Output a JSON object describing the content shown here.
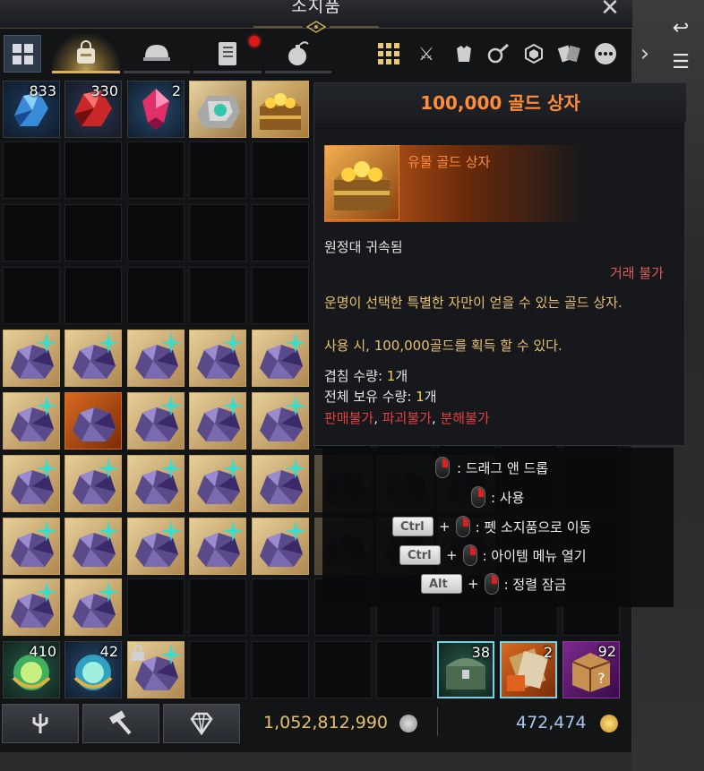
{
  "window": {
    "title": "소지품",
    "close_icon": "close-icon"
  },
  "tabs": [
    {
      "name": "bag",
      "icon": "bag-icon",
      "active": true
    },
    {
      "name": "mount",
      "icon": "helmet-icon",
      "active": false
    },
    {
      "name": "book",
      "icon": "book-icon",
      "active": false,
      "notification": true
    },
    {
      "name": "bomb",
      "icon": "bomb-icon",
      "active": false
    }
  ],
  "filters": [
    "grid-icon",
    "crossed-swords-icon",
    "armor-icon",
    "pan-icon",
    "gem-icon",
    "cards-icon",
    "more-icon"
  ],
  "inventory": {
    "row1": [
      {
        "qty": "833",
        "kind": "blue-crystal"
      },
      {
        "qty": "330",
        "kind": "red-crystal"
      },
      {
        "qty": "2",
        "kind": "pink-gem"
      },
      {
        "qty": "",
        "kind": "silver-relic"
      },
      {
        "qty": "",
        "kind": "gold-chest"
      }
    ],
    "ore_count_rows": [
      5,
      5,
      8,
      8,
      2
    ],
    "bottom_left": [
      {
        "qty": "410",
        "kind": "green-orb"
      },
      {
        "qty": "42",
        "kind": "blue-orb"
      },
      {
        "qty": "",
        "kind": "locked-ore"
      }
    ],
    "bottom_right": [
      {
        "qty": "38",
        "kind": "green-chest"
      },
      {
        "qty": "2",
        "kind": "card-pack"
      },
      {
        "qty": "92",
        "kind": "mystery-box"
      }
    ]
  },
  "tooltip": {
    "title": "100,000 골드 상자",
    "grade": "유물 골드 상자",
    "bound": "원정대 귀속됨",
    "trade": "거래 불가",
    "description": "운명이 선택한 특별한 자만이 얻을 수 있는 골드 상자.",
    "use_effect": "사용 시, 100,000골드를 획득 할 수 있다.",
    "stack_label": "겹침 수량: ",
    "stack_value": "1",
    "stack_unit": "개",
    "total_label": "전체 보유 수량: ",
    "total_value": "1",
    "total_unit": "개",
    "restrict_1": "판매불가",
    "restrict_sep": ", ",
    "restrict_2": "파괴불가",
    "restrict_3": "분해불가"
  },
  "help": {
    "drag": ": 드래그 앤 드롭",
    "use": ": 사용",
    "ctrl_key": "Ctrl",
    "move_pet": ": 펫 소지품으로 이동",
    "item_menu": ": 아이템 메뉴 열기",
    "alt_key": "Alt",
    "sort_lock": ": 정렬 잠금",
    "plus": "+"
  },
  "currency": {
    "silver": "1,052,812,990",
    "gold": "472,474"
  },
  "colors": {
    "accent_orange": "#ff8c3a",
    "gold_text": "#e8c068",
    "gold_blue_text": "#a8c8f0",
    "red_text": "#e04040"
  }
}
